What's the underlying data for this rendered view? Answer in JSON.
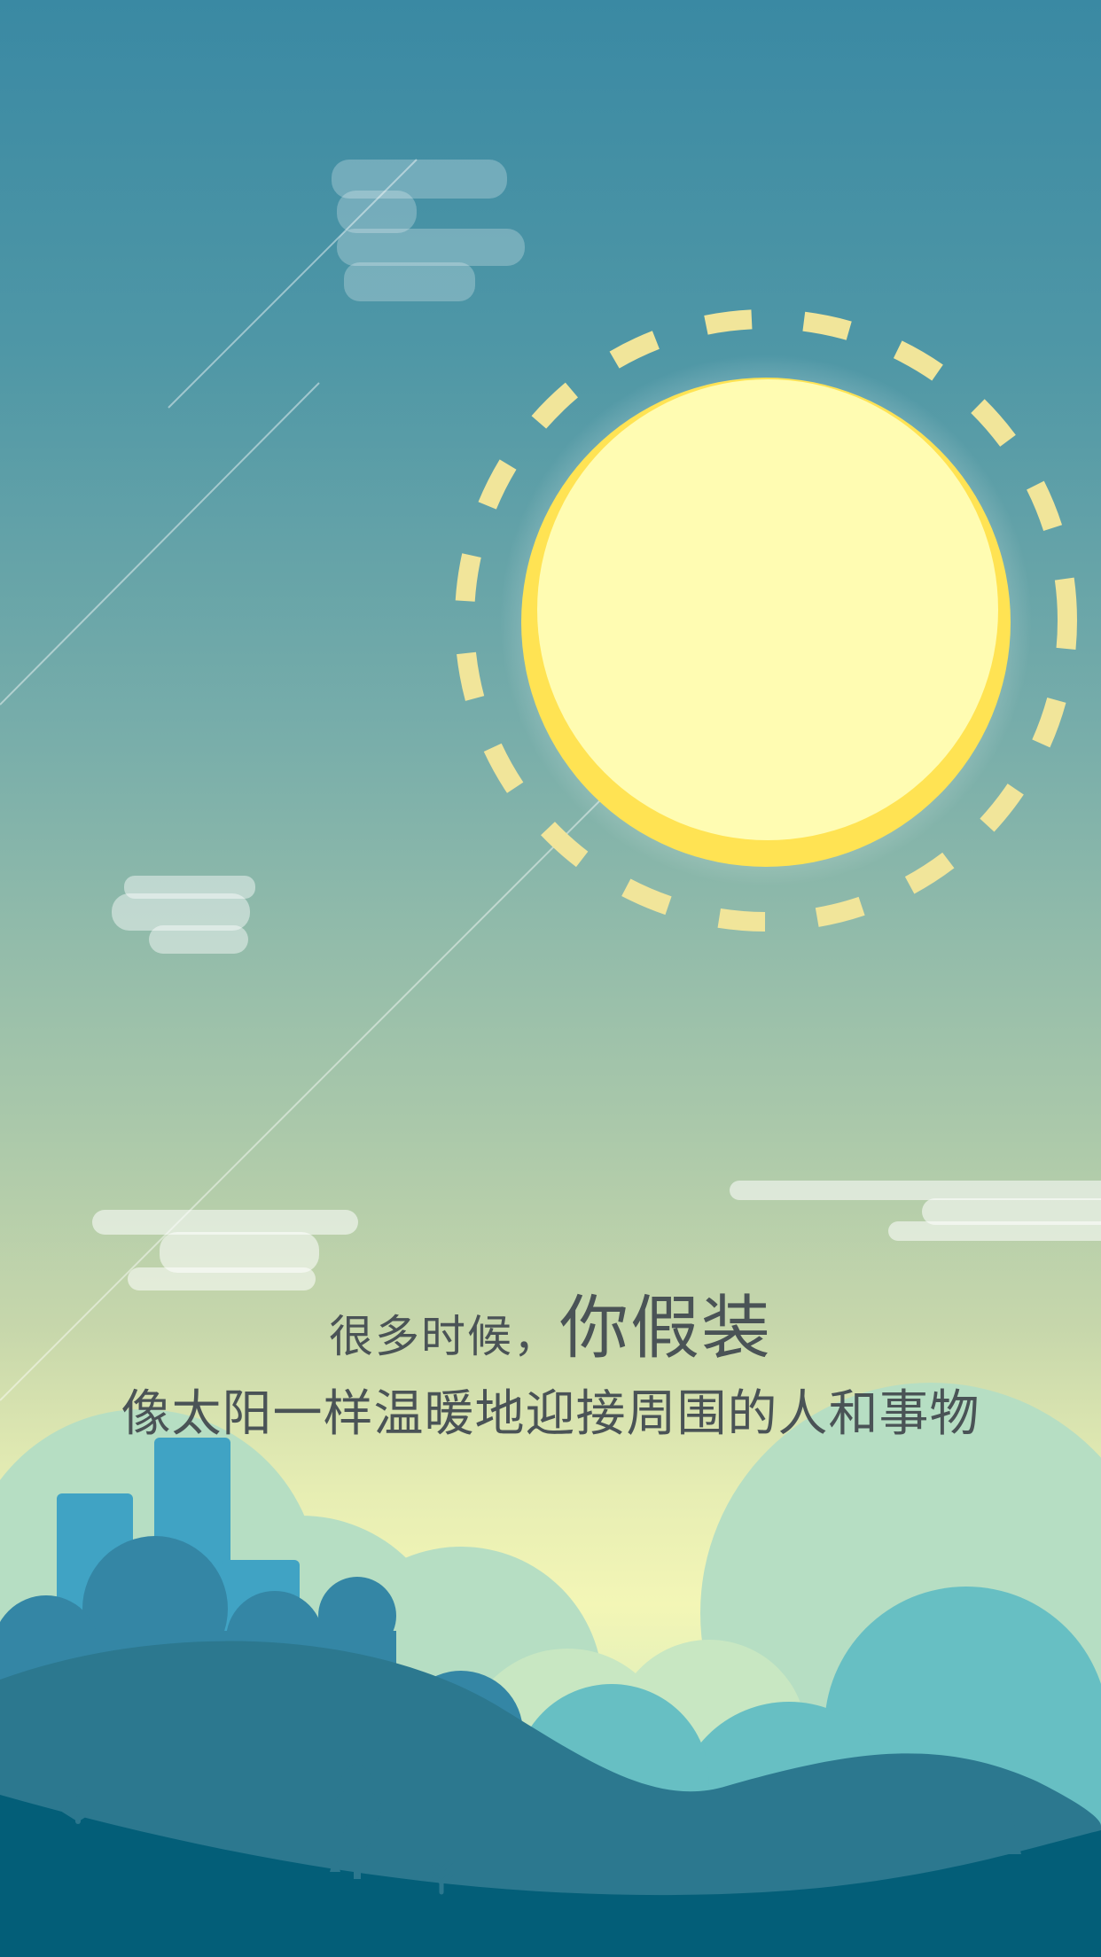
{
  "tagline": {
    "line1_small": "很多时候，",
    "line1_big": "你假装",
    "line2": "像太阳一样温暖地迎接周围的人和事物"
  },
  "colors": {
    "sky_top": "#3a89a3",
    "sky_bottom": "#f3f6b6",
    "sun_core": "#fffcb2",
    "sun_rim": "#ffe353",
    "sun_rays": "#f1e59a",
    "hill_dark": "#2c788f",
    "hill_front": "#035e78",
    "buildings": "#40a3c4",
    "bush_teal": "#67bfc3",
    "text": "#4a5356"
  },
  "icons": [
    "sun-icon",
    "cloud-icon",
    "tree-icon",
    "grass-icon"
  ]
}
